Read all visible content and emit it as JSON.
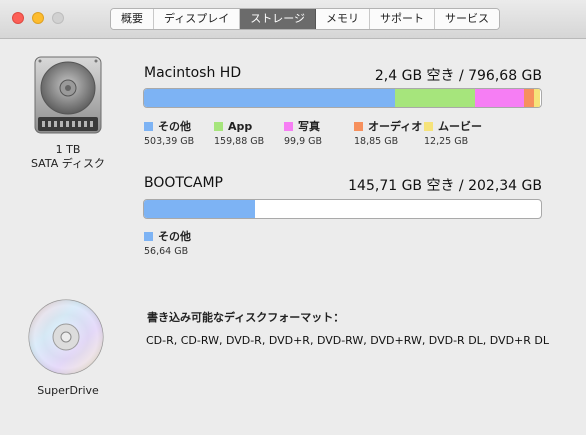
{
  "window": {
    "tabs": [
      {
        "label": "概要"
      },
      {
        "label": "ディスプレイ"
      },
      {
        "label": "ストレージ",
        "active": true
      },
      {
        "label": "メモリ"
      },
      {
        "label": "サポート"
      },
      {
        "label": "サービス"
      }
    ]
  },
  "disks": [
    {
      "capacity": "1 TB",
      "type": "SATA ディスク",
      "icon": "hard-drive-icon"
    },
    {
      "name": "SuperDrive",
      "icon": "optical-disc-icon"
    }
  ],
  "volumes": [
    {
      "name": "Macintosh HD",
      "free": "2,4 GB 空き / 796,68 GB",
      "segments": [
        {
          "label": "その他",
          "size": "503,39 GB",
          "color": "#7db3f4",
          "fraction": 0.632
        },
        {
          "label": "App",
          "size": "159,88 GB",
          "color": "#a6e57c",
          "fraction": 0.2007
        },
        {
          "label": "写真",
          "size": "99,9 GB",
          "color": "#f67ef4",
          "fraction": 0.1254
        },
        {
          "label": "オーディオ",
          "size": "18,85 GB",
          "color": "#f6905d",
          "fraction": 0.0237
        },
        {
          "label": "ムービー",
          "size": "12,25 GB",
          "color": "#f6e37a",
          "fraction": 0.0154
        }
      ]
    },
    {
      "name": "BOOTCAMP",
      "free": "145,71 GB 空き / 202,34 GB",
      "segments": [
        {
          "label": "その他",
          "size": "56,64 GB",
          "color": "#7db3f4",
          "fraction": 0.2799
        }
      ]
    }
  ],
  "writable_formats": {
    "title": "書き込み可能なディスクフォーマット：",
    "list": "CD-R, CD-RW, DVD-R, DVD+R, DVD-RW, DVD+RW, DVD-R DL, DVD+R DL"
  }
}
